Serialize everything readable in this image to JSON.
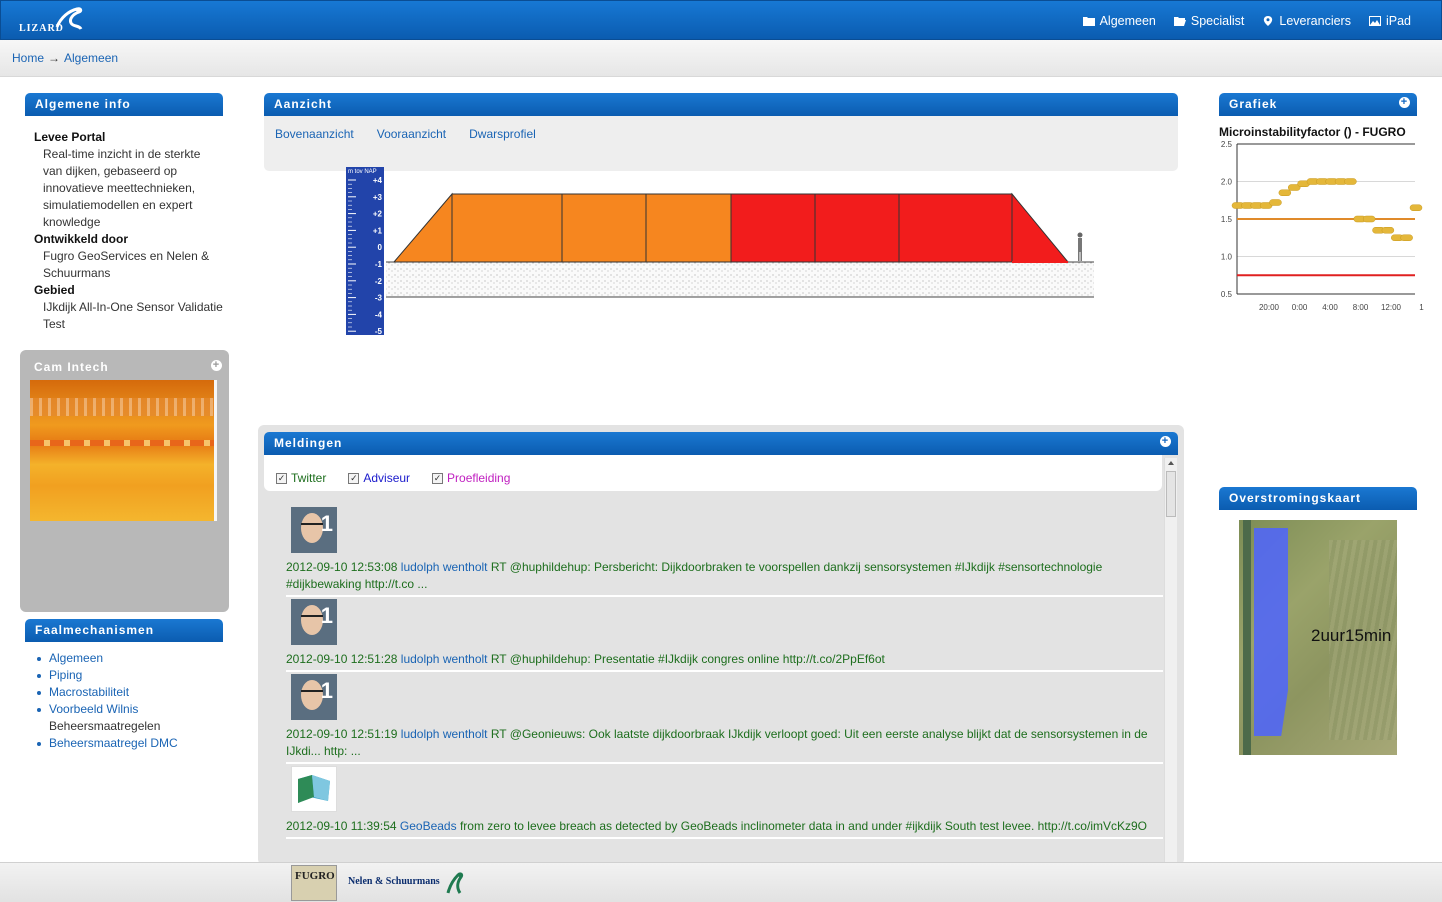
{
  "app": {
    "logo_text": "LIZARD"
  },
  "topnav": [
    {
      "label": "Algemeen",
      "icon": "folder-icon"
    },
    {
      "label": "Specialist",
      "icon": "folder-open-icon"
    },
    {
      "label": "Leveranciers",
      "icon": "map-marker-icon"
    },
    {
      "label": "iPad",
      "icon": "picture-icon"
    }
  ],
  "breadcrumb": {
    "home": "Home",
    "separator": "→",
    "current": "Algemeen"
  },
  "info": {
    "title": "Algemene info",
    "terms": [
      {
        "term": "Levee Portal",
        "def": "Real-time inzicht in de sterkte van dijken, gebaseerd op innovatieve meettechnieken, simulatiemodellen en expert knowledge"
      },
      {
        "term": "Ontwikkeld door",
        "def": "Fugro GeoServices en Nelen & Schuurmans"
      },
      {
        "term": "Gebied",
        "def": "IJkdijk All-In-One Sensor Validatie Test"
      }
    ]
  },
  "cam": {
    "title": "Cam Intech"
  },
  "faal": {
    "title": "Faalmechanismen",
    "items": [
      "Algemeen",
      "Piping",
      "Macrostabiliteit",
      "Voorbeeld Wilnis",
      "Beheersmaatregelen",
      "Beheersmaatregel DMC"
    ]
  },
  "aanzicht": {
    "title": "Aanzicht",
    "tabs": [
      "Bovenaanzicht",
      "Vooraanzicht",
      "Dwarsprofiel"
    ],
    "ruler_label": "m tov NAP",
    "ruler_ticks": [
      "+4",
      "+3",
      "+2",
      "+1",
      "0",
      "-1",
      "-2",
      "-3",
      "-4",
      "-5"
    ],
    "segments": [
      {
        "status": "orange",
        "color": "#f6861f"
      },
      {
        "status": "orange",
        "color": "#f6861f"
      },
      {
        "status": "orange",
        "color": "#f6861f"
      },
      {
        "status": "red",
        "color": "#f21c1c"
      },
      {
        "status": "red",
        "color": "#f21c1c"
      },
      {
        "status": "red",
        "color": "#f21c1c"
      }
    ]
  },
  "meldingen": {
    "title": "Meldingen",
    "filters": [
      {
        "label": "Twitter",
        "checked": true,
        "color": "#1d6e1d"
      },
      {
        "label": "Adviseur",
        "checked": true,
        "color": "#1a1acc"
      },
      {
        "label": "Proefleiding",
        "checked": true,
        "color": "#c020c0"
      }
    ],
    "items": [
      {
        "avatar": "person",
        "timestamp": "2012-09-10 12:53:08",
        "user": "ludolph wentholt",
        "text": "RT @huphildehup: Persbericht: Dijkdoorbraken te voorspellen dankzij sensorsystemen #IJkdijk #sensortechnologie #dijkbewaking http://t.co ..."
      },
      {
        "avatar": "person",
        "timestamp": "2012-09-10 12:51:28",
        "user": "ludolph wentholt",
        "text": "RT @huphildehup: Presentatie #IJkdijk congres online http://t.co/2PpEf6ot"
      },
      {
        "avatar": "person",
        "timestamp": "2012-09-10 12:51:19",
        "user": "ludolph wentholt",
        "text": "RT @Geonieuws: Ook laatste dijkdoorbraak IJkdijk verloopt goed: Uit een eerste analyse blijkt dat de sensorsystemen in de IJkdi... http: ..."
      },
      {
        "avatar": "geobeads",
        "timestamp": "2012-09-10 11:39:54",
        "user": "GeoBeads",
        "text": "from zero to levee breach as detected by GeoBeads inclinometer data in and under #ijkdijk South test levee. http://t.co/imVcKz9O"
      }
    ]
  },
  "grafiek": {
    "title": "Grafiek",
    "chart_title": "Microinstabilityfactor () - FUGRO"
  },
  "chart_data": {
    "type": "line",
    "title": "Microinstabilityfactor () - FUGRO",
    "ylim": [
      0.5,
      2.5
    ],
    "yticks": [
      "2.5",
      "2.0",
      "1.5",
      "1.0",
      "0.5"
    ],
    "xticks": [
      "20:00",
      "0:00",
      "4:00",
      "8:00",
      "12:00",
      "1"
    ],
    "series": [
      {
        "values": [
          1.68,
          1.68,
          1.68,
          1.68,
          1.72,
          1.85,
          1.92,
          1.97,
          2.0,
          2.0,
          2.0,
          2.0,
          2.0,
          1.5,
          1.5,
          1.35,
          1.35,
          1.25,
          1.25,
          1.65
        ]
      }
    ],
    "reference_lines": [
      {
        "value": 1.5,
        "color": "#e08a2a"
      },
      {
        "value": 0.75,
        "color": "#e02020"
      }
    ]
  },
  "kaart": {
    "title": "Overstromingskaart",
    "label": "2uur15min"
  },
  "footer": {
    "fugro": "FUGRO",
    "nelen": "Nelen & Schuurmans"
  }
}
